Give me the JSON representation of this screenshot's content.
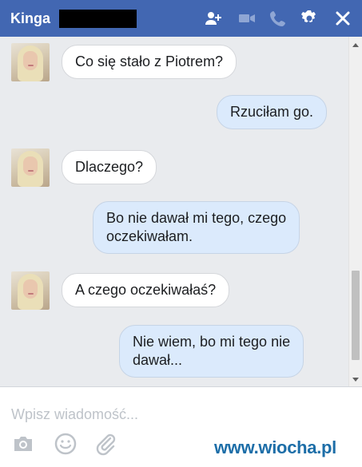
{
  "header": {
    "title": "Kinga",
    "icons": [
      "add-person-icon",
      "video-call-icon",
      "phone-icon",
      "gear-icon",
      "close-icon"
    ],
    "background": "#4267b2"
  },
  "messages": [
    {
      "from": "other",
      "text": "Co się stało z Piotrem?"
    },
    {
      "from": "me",
      "text": "Rzuciłam go."
    },
    {
      "from": "other",
      "text": "Dlaczego?"
    },
    {
      "from": "me",
      "lines": [
        "Bo nie dawał mi tego, czego",
        "oczekiwałam."
      ]
    },
    {
      "from": "other",
      "text": "A czego oczekiwałaś?"
    },
    {
      "from": "me",
      "lines": [
        "Nie wiem, bo mi tego nie",
        "dawał..."
      ]
    }
  ],
  "composer": {
    "placeholder": "Wpisz wiadomość...",
    "icons": [
      "camera-icon",
      "emoji-icon",
      "attachment-icon"
    ]
  },
  "watermark": {
    "text": "www.wiocha.pl"
  },
  "colors": {
    "outgoing_bubble": "#dbeafc",
    "incoming_bubble": "#ffffff",
    "chat_background": "#e9ebee"
  }
}
